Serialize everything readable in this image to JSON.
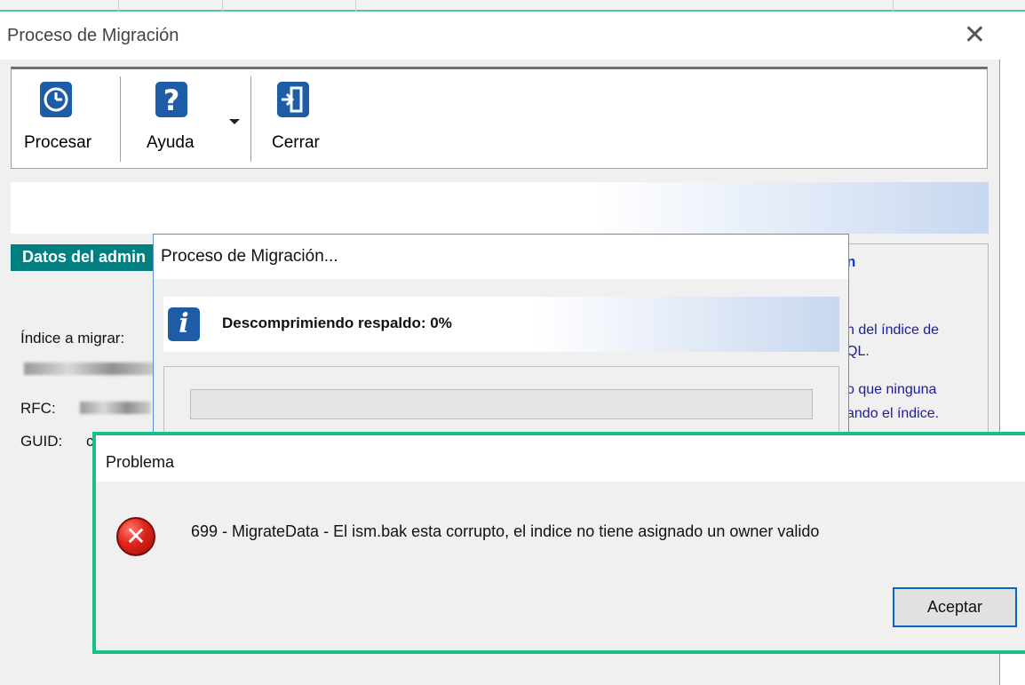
{
  "main_window": {
    "title": "Proceso de Migración",
    "close_glyph": "✕",
    "toolbar": {
      "process_label": "Procesar",
      "help_label": "Ayuda",
      "close_label": "Cerrar"
    },
    "left_panel": {
      "header": "Datos del admin",
      "index_label": "Índice a migrar:",
      "rfc_label": "RFC:",
      "guid_label": "GUID:",
      "guid_value_fragment": "c"
    },
    "right_panel": {
      "header_fragment": "n",
      "line1": "n del índice de",
      "line2": "QL.",
      "line3": "o que ninguna",
      "line4": "ando el índice."
    }
  },
  "progress_dialog": {
    "title": "Proceso de Migración...",
    "status": "Descomprimiendo respaldo: 0%",
    "progress_fraction": 0
  },
  "error_dialog": {
    "title": "Problema",
    "message": "699 - MigrateData - El ism.bak esta corrupto, el indice no tiene asignado un owner valido",
    "accept_label": "Aceptar"
  },
  "colors": {
    "accent_teal": "#008080",
    "icon_blue": "#1f5ca8",
    "error_red": "#e0231a",
    "error_dialog_border": "#17c08a",
    "link_text": "#1d1d9a"
  }
}
